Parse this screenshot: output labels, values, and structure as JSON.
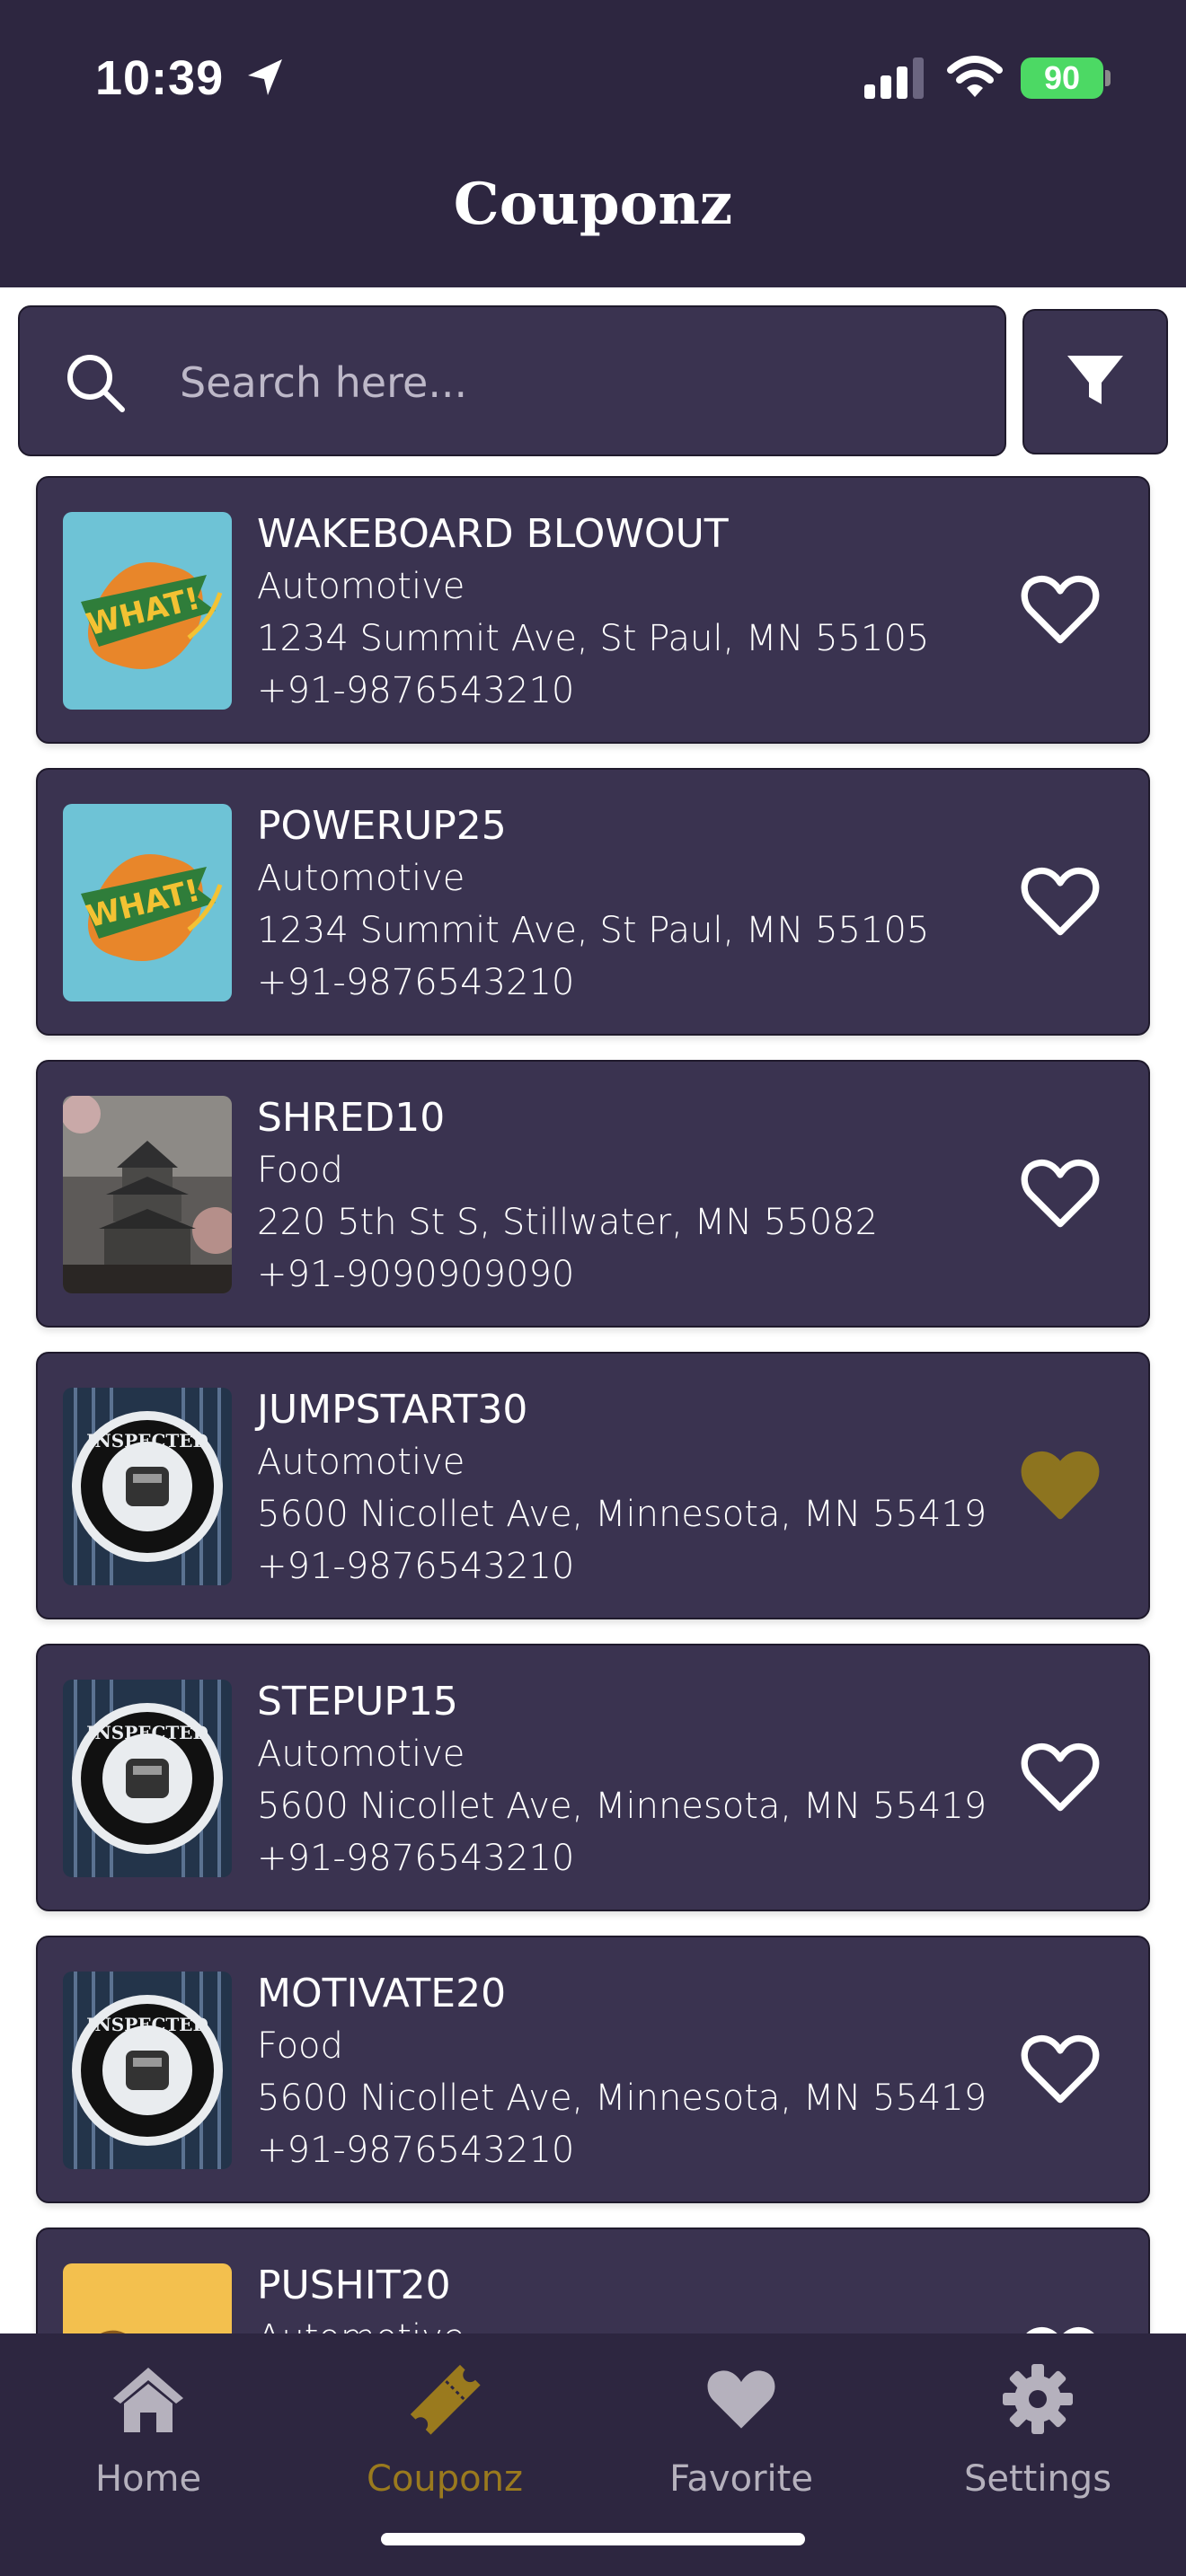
{
  "status_bar": {
    "time": "10:39",
    "battery": "90"
  },
  "header": {
    "title": "Couponz"
  },
  "search": {
    "placeholder": "Search here..."
  },
  "icons": {
    "search": "search-icon",
    "filter": "filter-icon",
    "favorite": "heart-icon",
    "home": "home-icon",
    "coupons": "ticket-icon",
    "settings": "gear-icon"
  },
  "colors": {
    "header_bg": "#2d2640",
    "card_bg": "#3a3350",
    "accent": "#9a7a1e",
    "inactive_nav": "#b5b1bd"
  },
  "coupons": [
    {
      "name": "WAKEBOARD BLOWOUT",
      "category": "Automotive",
      "address": "1234 Summit Ave, St Paul, MN 55105",
      "phone": "+91-9876543210",
      "favorite": false,
      "image": "what-logo"
    },
    {
      "name": "POWERUP25",
      "category": "Automotive",
      "address": "1234 Summit Ave, St Paul, MN 55105",
      "phone": "+91-9876543210",
      "favorite": false,
      "image": "what-logo"
    },
    {
      "name": "SHRED10",
      "category": "Food",
      "address": "220 5th St S, Stillwater, MN 55082",
      "phone": "+91-9090909090",
      "favorite": false,
      "image": "castle-photo"
    },
    {
      "name": "JUMPSTART30",
      "category": "Automotive",
      "address": "5600 Nicollet Ave, Minnesota, MN 55419",
      "phone": "+91-9876543210",
      "favorite": true,
      "image": "inspected-badge"
    },
    {
      "name": "STEPUP15",
      "category": "Automotive",
      "address": "5600 Nicollet Ave, Minnesota, MN 55419",
      "phone": "+91-9876543210",
      "favorite": false,
      "image": "inspected-badge"
    },
    {
      "name": "MOTIVATE20",
      "category": "Food",
      "address": "5600 Nicollet Ave, Minnesota, MN 55419",
      "phone": "+91-9876543210",
      "favorite": false,
      "image": "inspected-badge"
    },
    {
      "name": "PUSHIT20",
      "category": "Automotive",
      "address": "",
      "phone": "",
      "favorite": false,
      "image": "yellow-logo"
    }
  ],
  "nav": [
    {
      "label": "Home",
      "icon": "home-icon",
      "active": false
    },
    {
      "label": "Couponz",
      "icon": "ticket-icon",
      "active": true
    },
    {
      "label": "Favorite",
      "icon": "heart-icon",
      "active": false
    },
    {
      "label": "Settings",
      "icon": "gear-icon",
      "active": false
    }
  ]
}
